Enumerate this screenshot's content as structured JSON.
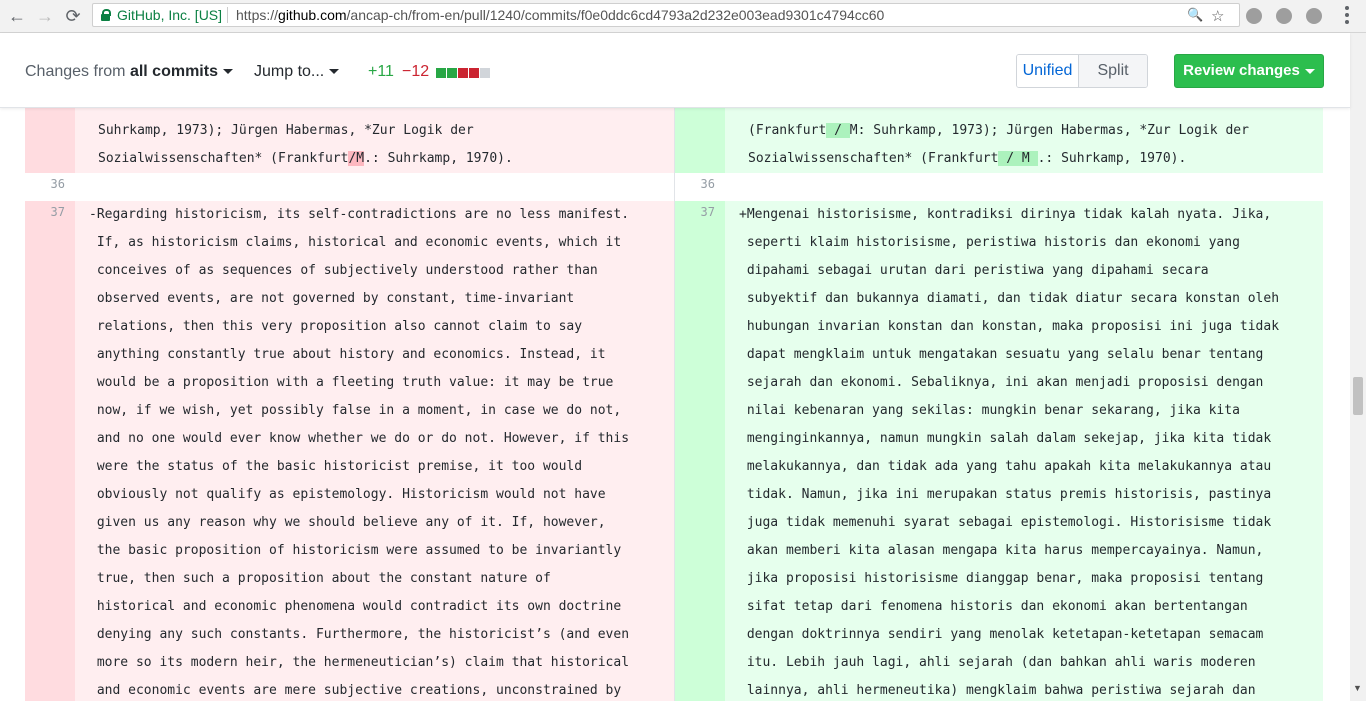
{
  "browser": {
    "site_identity": "GitHub, Inc. [US]",
    "url_prefix": "https://",
    "url_host": "github.com",
    "url_path": "/ancap-ch/from-en/pull/1240/commits/f0e0ddc6cd4793a2d232e003ead9301c4794cc60",
    "back_icon": "←",
    "forward_icon": "→",
    "reload_icon": "⟳",
    "zoom_icon": "🔍",
    "star_icon": "☆"
  },
  "toolbar": {
    "changes_from_prefix": "Changes from ",
    "changes_from_value": "all commits",
    "jump_to": "Jump to...",
    "additions": "+11",
    "deletions": "−12",
    "diffstat_blocks": [
      "#28a745",
      "#28a745",
      "#cb2431",
      "#cb2431",
      "#d1d5da"
    ],
    "view_unified": "Unified",
    "view_split": "Split",
    "review_changes": "Review changes"
  },
  "diff": {
    "left": {
      "top_lines": [
        {
          "pre": "",
          "mark": "",
          "post": "Suhrkamp, 1973); Jürgen Habermas, *Zur Logik der"
        },
        {
          "pre": "Sozialwissenschaften* (Frankfurt",
          "mark": "/M",
          "post": ".: Suhrkamp, 1970)."
        }
      ],
      "context_line_number": "36",
      "line_number": "37",
      "lines": [
        "-Regarding historicism, its self-contradictions are no less manifest.",
        " If, as historicism claims, historical and economic events, which it",
        " conceives of as sequences of subjectively understood rather than",
        " observed events, are not governed by constant, time-invariant",
        " relations, then this very proposition also cannot claim to say",
        " anything constantly true about history and economics. Instead, it",
        " would be a proposition with a fleeting truth value: it may be true",
        " now, if we wish, yet possibly false in a moment, in case we do not,",
        " and no one would ever know whether we do or do not. However, if this",
        " were the status of the basic historicist premise, it too would",
        " obviously not qualify as epistemology. Historicism would not have",
        " given us any reason why we should believe any of it. If, however,",
        " the basic proposition of historicism were assumed to be invariantly",
        " true, then such a proposition about the constant nature of",
        " historical and economic phenomena would contradict its own doctrine",
        " denying any such constants. Furthermore, the historicist’s (and even",
        " more so its modern heir, the hermeneutician’s) claim that historical",
        " and economic events are mere subjective creations, unconstrained by"
      ]
    },
    "right": {
      "top_lines": [
        {
          "pre": "(Frankfurt",
          "mark": " / ",
          "post": "M: Suhrkamp, 1973); Jürgen Habermas, *Zur Logik der"
        },
        {
          "pre": "Sozialwissenschaften* (Frankfurt",
          "mark": " / M ",
          "post": ".: Suhrkamp, 1970)."
        }
      ],
      "context_line_number": "36",
      "line_number": "37",
      "lines": [
        "+Mengenai historisisme, kontradiksi dirinya tidak kalah nyata. Jika,",
        " seperti klaim historisisme, peristiwa historis dan ekonomi yang",
        " dipahami sebagai urutan dari peristiwa yang dipahami secara",
        " subyektif dan bukannya diamati, dan tidak diatur secara konstan oleh",
        " hubungan invarian konstan dan konstan, maka proposisi ini juga tidak",
        " dapat mengklaim untuk mengatakan sesuatu yang selalu benar tentang",
        " sejarah dan ekonomi. Sebaliknya, ini akan menjadi proposisi dengan",
        " nilai kebenaran yang sekilas: mungkin benar sekarang, jika kita",
        " menginginkannya, namun mungkin salah dalam sekejap, jika kita tidak",
        " melakukannya, dan tidak ada yang tahu apakah kita melakukannya atau",
        " tidak. Namun, jika ini merupakan status premis historisis, pastinya",
        " juga tidak memenuhi syarat sebagai epistemologi. Historisisme tidak",
        " akan memberi kita alasan mengapa kita harus mempercayainya. Namun,",
        " jika proposisi historisisme dianggap benar, maka proposisi tentang",
        " sifat tetap dari fenomena historis dan ekonomi akan bertentangan",
        " dengan doktrinnya sendiri yang menolak ketetapan-ketetapan semacam",
        " itu. Lebih jauh lagi, ahli sejarah (dan bahkan ahli waris moderen",
        " lainnya, ahli hermeneutika) mengklaim bahwa peristiwa sejarah dan"
      ]
    }
  }
}
